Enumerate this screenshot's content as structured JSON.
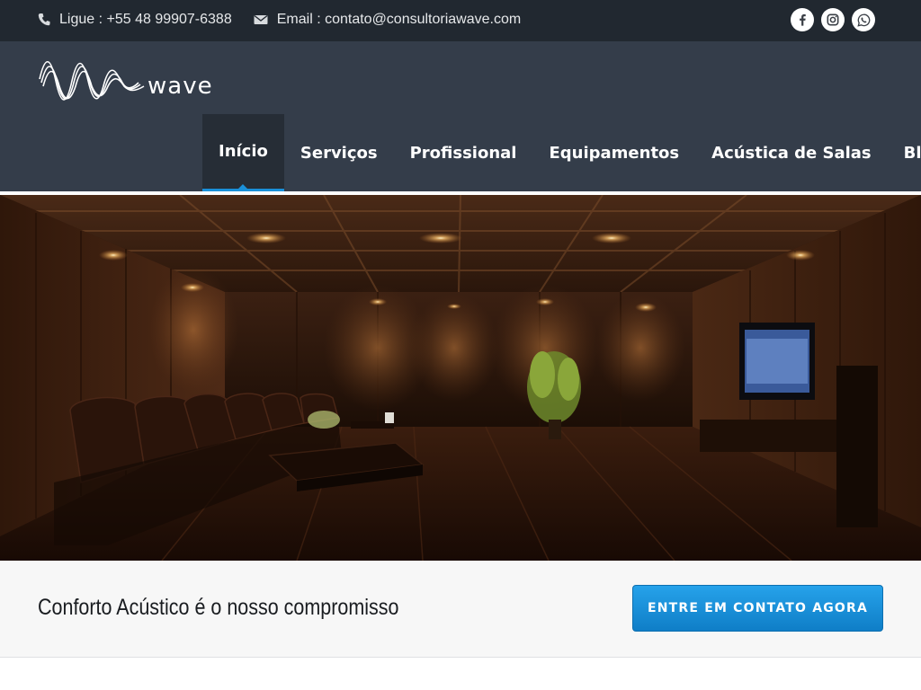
{
  "topbar": {
    "phone": "Ligue : +55 48 99907-6388",
    "email": "Email : contato@consultoriawave.com",
    "social": [
      {
        "name": "facebook-icon"
      },
      {
        "name": "instagram-icon"
      },
      {
        "name": "whatsapp-icon"
      }
    ]
  },
  "brand": {
    "logo_text": "wave"
  },
  "nav": {
    "items": [
      {
        "label": "Início",
        "active": true
      },
      {
        "label": "Serviços"
      },
      {
        "label": "Profissional"
      },
      {
        "label": "Equipamentos"
      },
      {
        "label": "Acústica de Salas"
      },
      {
        "label": "Blog"
      }
    ]
  },
  "cta": {
    "tagline": "Conforto Acústico é o nosso compromisso",
    "button_label": "Entre em contato agora"
  },
  "colors": {
    "topbar": "#212830",
    "header": "#343d4a",
    "accent": "#1a90d9",
    "cta_band": "#f7f7f7"
  }
}
